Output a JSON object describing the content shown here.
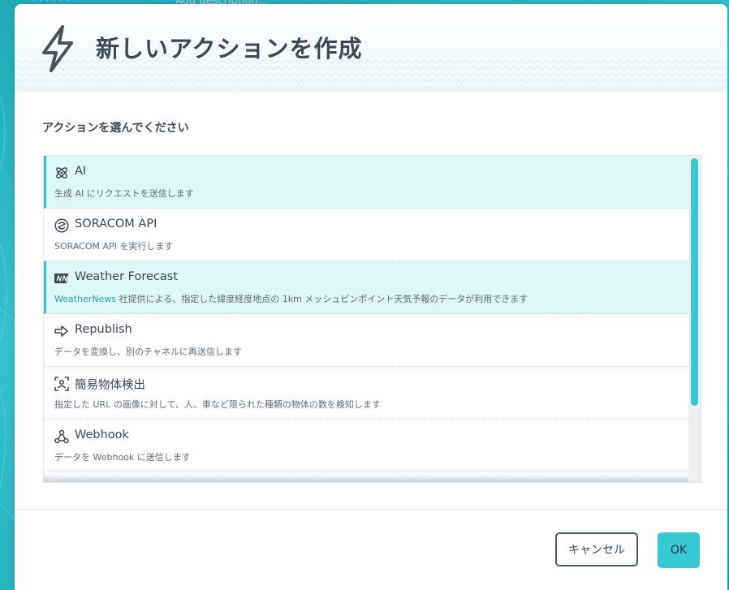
{
  "background": {
    "behind_text_left": "· · · · · ·",
    "behind_text_right": "Add description..."
  },
  "modal": {
    "title": "新しいアクションを作成",
    "header_icon": "lightning-bolt-icon",
    "section_label": "アクションを選んでください"
  },
  "actions": [
    {
      "icon": "atom-icon",
      "title": "AI",
      "desc": "生成 AI にリクエストを送信します",
      "selected": true
    },
    {
      "icon": "soracom-logo-icon",
      "title": "SORACOM API",
      "desc": "SORACOM API を実行します",
      "selected": false
    },
    {
      "icon": "weathernews-logo-icon",
      "title": "Weather Forecast",
      "desc_link": "WeatherNews",
      "desc": " 社提供による、指定した緯度経度地点の 1km メッシュピンポイント天気予報のデータが利用できます",
      "selected": true
    },
    {
      "icon": "arrow-right-icon",
      "title": "Republish",
      "desc": "データを変換し、別のチャネルに再送信します",
      "selected": false
    },
    {
      "icon": "object-detection-icon",
      "title": "簡易物体検出",
      "desc": "指定した URL の画像に対して、人、車など限られた種類の物体の数を検知します",
      "selected": false
    },
    {
      "icon": "webhook-icon",
      "title": "Webhook",
      "desc": "データを Webhook に送信します",
      "selected": false
    }
  ],
  "footer": {
    "cancel_label": "キャンセル",
    "ok_label": "OK"
  },
  "colors": {
    "accent": "#35c8d3",
    "selected_bg": "#ddf7f7",
    "text": "#3a4754"
  }
}
